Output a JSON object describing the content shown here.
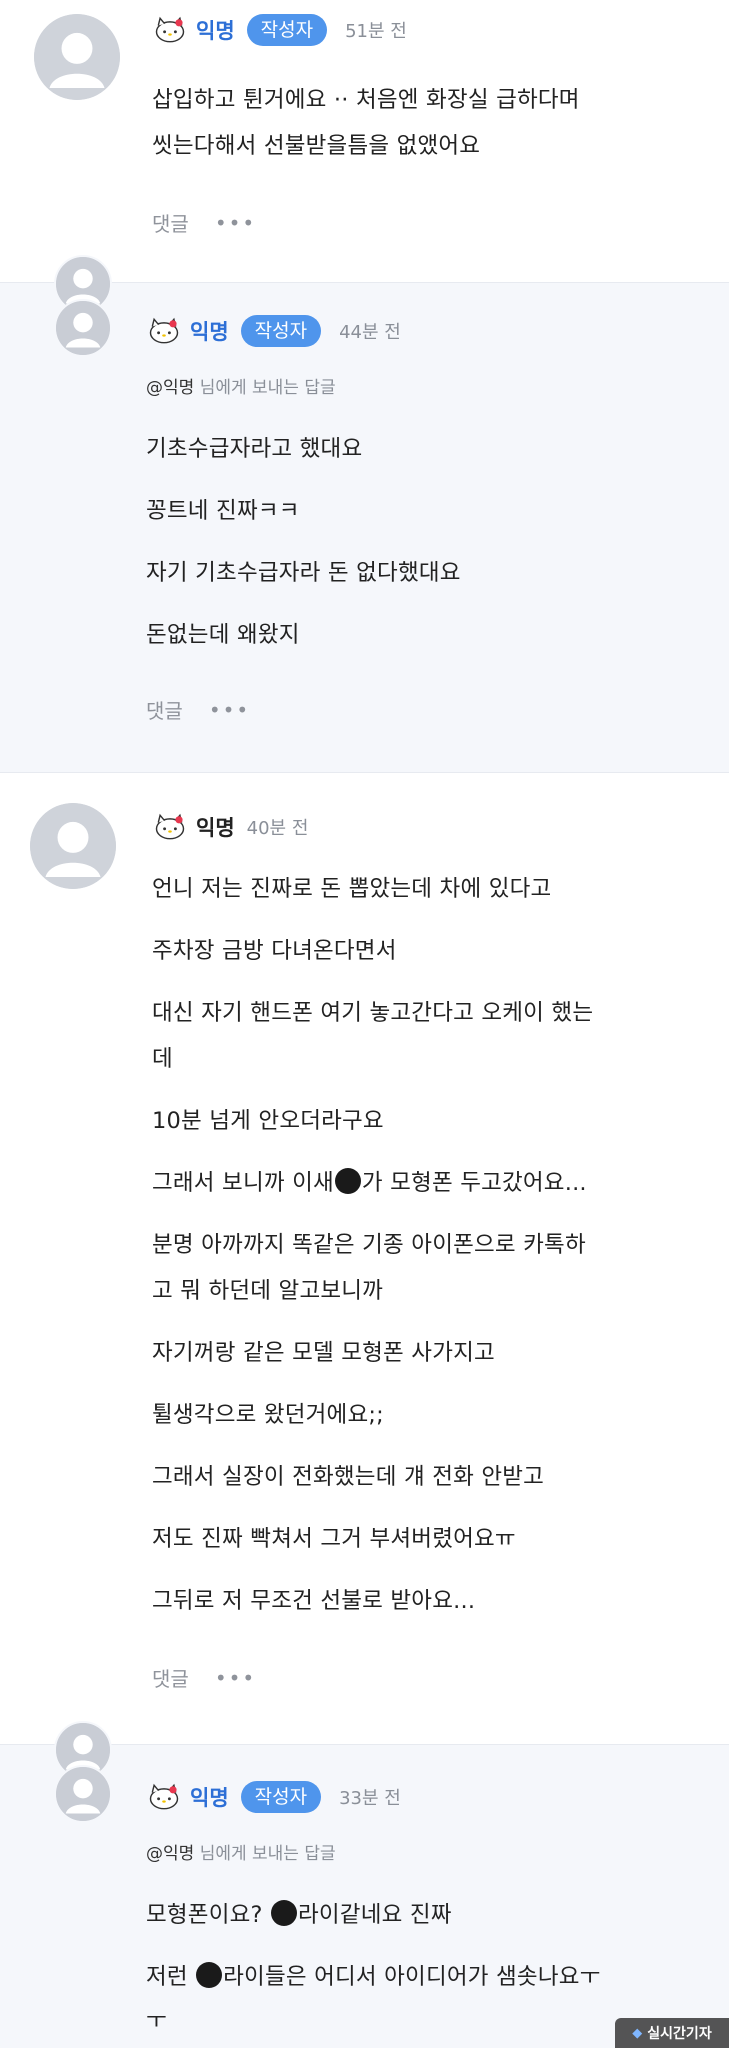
{
  "comments": [
    {
      "nickname": "익명",
      "badge": "작성자",
      "time": "51분 전",
      "lines": [
        "삽입하고 튄거에요 ·· 처음엔 화장실 급하다며",
        "씻는다해서 선불받을틈을 없앴어요"
      ],
      "reply_label": "댓글",
      "more_label": "•••"
    },
    {
      "nickname": "익명",
      "badge": "작성자",
      "time": "44분 전",
      "mention": "@익명",
      "mention_suffix": "님에게 보내는 답글",
      "lines": [
        "기초수급자라고 했대요",
        "꽁트네 진짜ㅋㅋ",
        "자기 기초수급자라 돈 없다했대요",
        "돈없는데 왜왔지"
      ],
      "reply_label": "댓글",
      "more_label": "•••"
    },
    {
      "nickname": "익명",
      "time": "40분 전",
      "lines": [
        "언니 저는 진짜로 돈 뽑았는데 차에 있다고",
        "주차장 금방 다녀온다면서",
        "대신 자기 핸드폰 여기 놓고간다고 오케이 했는",
        "데",
        "10분 넘게 안오더라구요",
        "그래서 보니까 이새",
        "가 모형폰 두고갔어요...",
        "분명 아까까지 똑같은 기종 아이폰으로 카톡하",
        "고 뭐 하던데 알고보니까",
        "자기꺼랑 같은 모델 모형폰 사가지고",
        "튈생각으로 왔던거에요;;",
        "그래서 실장이 전화했는데 걔 전화 안받고",
        "저도 진짜 빡쳐서 그거 부셔버렸어요ㅠ",
        "그뒤로 저 무조건 선불로 받아요..."
      ],
      "reply_label": "댓글",
      "more_label": "•••"
    },
    {
      "nickname": "익명",
      "badge": "작성자",
      "time": "33분 전",
      "mention": "@익명",
      "mention_suffix": "님에게 보내는 답글",
      "lines": [
        "모형폰이요? ",
        "라이같네요 진짜",
        "저런 ",
        "라이들은 어디서 아이디어가 샘솟나요ㅜ",
        "ㅜ"
      ]
    }
  ],
  "watermark": {
    "icon": "logo-icon",
    "text": "실시간기자"
  }
}
